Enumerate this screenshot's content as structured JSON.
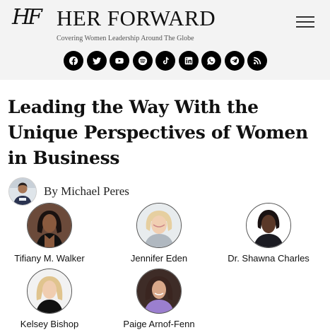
{
  "header": {
    "logo_text": "HF",
    "title": "HER FORWARD",
    "tagline": "Covering Women Leadership Around The Globe",
    "social_icons": [
      "facebook-icon",
      "twitter-icon",
      "youtube-icon",
      "spotify-icon",
      "tiktok-icon",
      "linkedin-icon",
      "whatsapp-icon",
      "telegram-icon",
      "rss-icon"
    ]
  },
  "article": {
    "headline": "Leading the Way With the Unique Perspectives of Women in Business",
    "byline": "By Michael Peres"
  },
  "people": [
    {
      "name": "Tifiany M. Walker"
    },
    {
      "name": "Jennifer Eden"
    },
    {
      "name": "Dr. Shawna Charles"
    },
    {
      "name": "Kelsey Bishop"
    },
    {
      "name": "Paige Arnof-Fenn"
    }
  ]
}
